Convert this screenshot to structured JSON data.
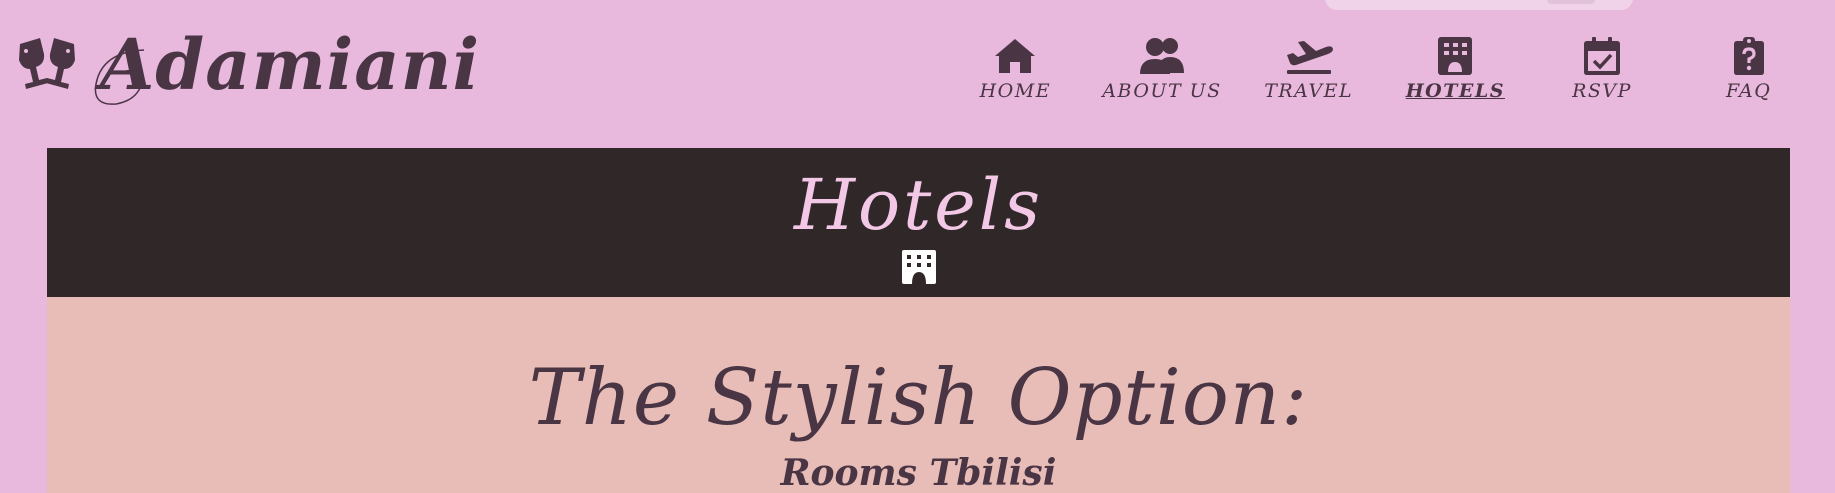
{
  "site": {
    "name": "Adamiani",
    "logo_icon": "champagne-glasses-icon"
  },
  "nav": {
    "items": [
      {
        "label": "HOME",
        "icon": "house-icon",
        "active": false
      },
      {
        "label": "ABOUT US",
        "icon": "users-icon",
        "active": false
      },
      {
        "label": "TRAVEL",
        "icon": "plane-departure-icon",
        "active": false
      },
      {
        "label": "HOTELS",
        "icon": "hotel-icon",
        "active": true
      },
      {
        "label": "RSVP",
        "icon": "calendar-check-icon",
        "active": false
      },
      {
        "label": "FAQ",
        "icon": "clipboard-question-icon",
        "active": false
      }
    ]
  },
  "banner": {
    "title": "Hotels",
    "icon": "hotel-icon"
  },
  "content": {
    "section_title": "The Stylish Option:",
    "hotel_name": "Rooms Tbilisi"
  },
  "colors": {
    "page_bg": "#e8b9dd",
    "banner_bg": "#302728",
    "banner_text": "#f3c7e6",
    "content_bg": "#e8bdb7",
    "text": "#4a3545"
  }
}
